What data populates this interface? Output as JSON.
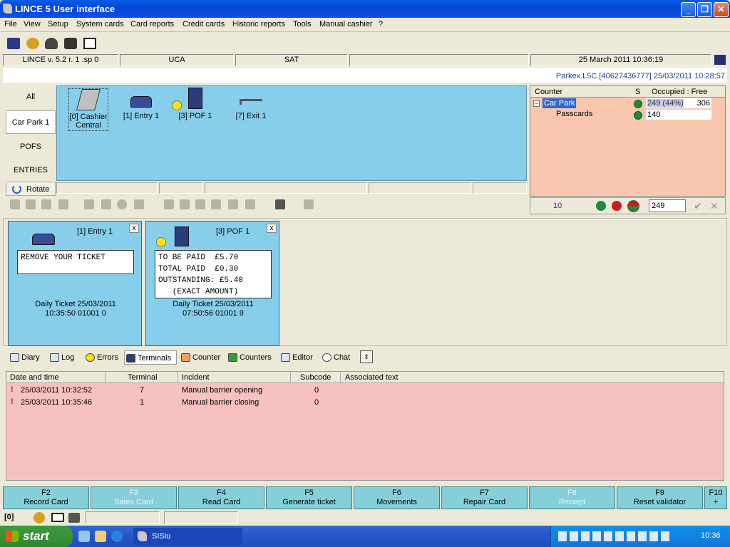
{
  "window": {
    "title": "LINCE 5 User interface",
    "minimize": "_",
    "maximize": "❐",
    "close": "✕"
  },
  "menu": [
    "File",
    "View",
    "Setup",
    "System cards",
    "Card reports",
    "Credit cards",
    "Historic reports",
    "Tools",
    "Manual cashier",
    "?"
  ],
  "status": {
    "version": "LINCE v. 5.2 r. 1 .sp 0",
    "site": "UCA",
    "day": "SAT",
    "datetime": "25 March 2011 10:36:19"
  },
  "server_info": "Parkex.L5C [40627436777] 25/03/2011 10:28:57",
  "nav": {
    "items": [
      "All",
      "Car Park 1",
      "POFS",
      "ENTRIES"
    ],
    "selected": "Car Park 1",
    "rotate": "Rotate"
  },
  "devices": [
    {
      "label1": "[0] Cashier",
      "label2": "Central",
      "icon": "cashier-icon"
    },
    {
      "label1": "[1] Entry 1",
      "label2": "",
      "icon": "car-icon"
    },
    {
      "label1": "[3] POF 1",
      "label2": "",
      "icon": "pay-machine-icon"
    },
    {
      "label1": "[7] Exit 1",
      "label2": "",
      "icon": "barrier-icon"
    }
  ],
  "counter": {
    "headers": {
      "counter": "Counter",
      "s": "S",
      "occupied_free": "Occupied : Free"
    },
    "rows": [
      {
        "name": "Car Park",
        "occupied": "249 (44%)",
        "free": "306"
      },
      {
        "name": "Passcards",
        "occupied": "140",
        "free": ""
      }
    ],
    "footer": {
      "value": "10",
      "spinner": "249",
      "ok": "✔",
      "cancel": "✕"
    }
  },
  "terminals": [
    {
      "title": "[1] Entry 1",
      "screen": "REMOVE YOUR TICKET",
      "footer1": "Daily Ticket 25/03/2011",
      "footer2": "10:35:50 01001 0",
      "close": "x"
    },
    {
      "title": "[3] POF 1",
      "screen": "TO BE PAID  £5.70\nTOTAL PAID  £0.30\nOUTSTANDING: £5.40\n   (EXACT AMOUNT)",
      "footer1": "Daily Ticket 25/03/2011",
      "footer2": "07:50:56 01001 9",
      "close": "x"
    }
  ],
  "tabs": [
    "Diary",
    "Log",
    "Errors",
    "Terminals",
    "Counter",
    "Counters",
    "Editor",
    "Chat"
  ],
  "tab_selected": "Terminals",
  "grid": {
    "headers": [
      "Date and time",
      "Terminal",
      "Incident",
      "Subcode",
      "Associated text"
    ],
    "rows": [
      {
        "datetime": "25/03/2011 10:32:52",
        "terminal": "7",
        "incident": "Manual barrier opening",
        "subcode": "0",
        "text": ""
      },
      {
        "datetime": "25/03/2011 10:35:46",
        "terminal": "1",
        "incident": "Manual barrier closing",
        "subcode": "0",
        "text": ""
      }
    ]
  },
  "fkeys": [
    {
      "key": "F2",
      "label": "Record Card",
      "enabled": true
    },
    {
      "key": "F3",
      "label": "Sales Card",
      "enabled": false
    },
    {
      "key": "F4",
      "label": "Read Card",
      "enabled": true
    },
    {
      "key": "F5",
      "label": "Generate ticket",
      "enabled": true
    },
    {
      "key": "F6",
      "label": "Movements",
      "enabled": true
    },
    {
      "key": "F7",
      "label": "Repair Card",
      "enabled": true
    },
    {
      "key": "F8",
      "label": "Receipt",
      "enabled": false
    },
    {
      "key": "F9",
      "label": "Reset validator",
      "enabled": true
    },
    {
      "key": "F10",
      "label": "+",
      "enabled": true
    }
  ],
  "bottom_status": {
    "index": "[0]"
  },
  "taskbar": {
    "start": "start",
    "task": "SISiu",
    "clock": "10:36"
  },
  "colors": {
    "blue_area": "#87ceeb",
    "counter_bg": "#f9c7ad",
    "grid_bg": "#f8c1c1",
    "fkey_bg": "#85cfd8",
    "status_ok": "#1e8a3a"
  }
}
